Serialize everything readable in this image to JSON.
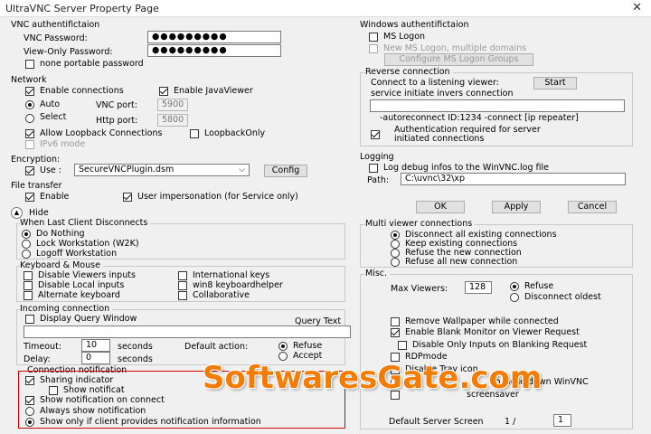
{
  "window": {
    "title": "UltraVNC Server Property Page",
    "close": "✕"
  },
  "vnc_auth": {
    "group": "VNC authentifictaion",
    "vnc_password_label": "VNC Password:",
    "vnc_password_value": "●●●●●●●●●",
    "viewonly_label": "View-Only Password:",
    "viewonly_value": "●●●●●●●●●",
    "none_portable": "none portable password"
  },
  "network": {
    "group": "Network",
    "enable_connections": "Enable connections",
    "enable_javaviewer": "Enable JavaViewer",
    "auto": "Auto",
    "select": "Select",
    "vnc_port_label": "VNC port:",
    "vnc_port_value": "5900",
    "http_port_label": "Http port:",
    "http_port_value": "5800",
    "allow_loopback": "Allow Loopback Connections",
    "loopback_only": "LoopbackOnly",
    "ipv6": "IPv6 mode"
  },
  "encryption": {
    "group": "Encryption:",
    "use": "Use :",
    "plugin": "SecureVNCPlugin.dsm",
    "config": "Config"
  },
  "file_transfer": {
    "group": "File transfer",
    "enable": "Enable",
    "user_impersonation": "User impersonation (for Service only)"
  },
  "hide": {
    "label": "Hide",
    "icon": "chevron-up-icon"
  },
  "last_client": {
    "group": "When Last Client Disconnects",
    "do_nothing": "Do Nothing",
    "lock": "Lock Workstation (W2K)",
    "logoff": "Logoff Workstation"
  },
  "keyboard_mouse": {
    "group": "Keyboard & Mouse",
    "disable_viewers_inputs": "Disable Viewers inputs",
    "disable_local_inputs": "Disable Local inputs",
    "alternate_keyboard": "Alternate keyboard",
    "international_keys": "International keys",
    "win8_helper": "win8 keyboardhelper",
    "collaborative": "Collaborative"
  },
  "incoming": {
    "group": "Incoming connection",
    "display_query_window": "Display Query Window",
    "query_text_label": "Query Text",
    "timeout_label": "Timeout:",
    "timeout_value": "10",
    "timeout_unit": "seconds",
    "delay_label": "Delay:",
    "delay_value": "0",
    "delay_unit": "seconds",
    "default_action_label": "Default action:",
    "refuse": "Refuse",
    "accept": "Accept"
  },
  "notification": {
    "group": "Connection notification",
    "sharing_indicator": "Sharing indicator",
    "show_notification": "Show notificat",
    "show_on_connect": "Show notification on connect",
    "always_show": "Always show notification",
    "show_only_if": "Show only if client provides notification information"
  },
  "windows_auth": {
    "group": "Windows authentifictaion",
    "ms_logon": "MS Logon",
    "new_ms_logon": "New MS Logon, multiple domains",
    "configure": "Configure MS Logon Groups"
  },
  "reverse": {
    "group": "Reverse connection",
    "connect_label": "Connect to a listening viewer:",
    "start": "Start",
    "service_label": "service initiate invers connection",
    "autoreconnect": "-autoreconnect ID:1234 -connect [ip repeater]",
    "auth_required": "Authentication required for server initiated connections"
  },
  "logging": {
    "group": "Logging",
    "log_debug": "Log debug infos to the WinVNC.log file",
    "path_label": "Path:",
    "path_value": "C:\\uvnc\\32\\xp"
  },
  "buttons": {
    "ok": "OK",
    "apply": "Apply",
    "cancel": "Cancel"
  },
  "multi_viewer": {
    "group": "Multi viewer connections",
    "disconnect_all": "Disconnect all existing connections",
    "keep_existing": "Keep existing connections",
    "refuse_new": "Refuse the new connection",
    "refuse_all": "Refuse all new connection"
  },
  "misc": {
    "group": "Misc.",
    "max_viewers_label": "Max Viewers:",
    "max_viewers_value": "128",
    "refuse": "Refuse",
    "disconnect_oldest": "Disconnect oldest",
    "remove_wallpaper": "Remove Wallpaper while connected",
    "enable_blank": "Enable Blank Monitor on Viewer Request",
    "disable_only_inputs": "Disable Only Inputs on Blanking Request",
    "rdp_mode": "RDPmode",
    "disable_tray": "Disable Tray icon",
    "allow_close": "to close down WinVNC",
    "screensaver": "screensaver",
    "default_screen_label": "Default Server Screen",
    "default_screen_of": "1 /",
    "default_screen_value": "1"
  },
  "watermark": {
    "text": "SoftwaresGate.com",
    "color": "#f57c00"
  },
  "colors": {
    "background": "#f0f0f0",
    "highlight_box": "#d40000"
  }
}
